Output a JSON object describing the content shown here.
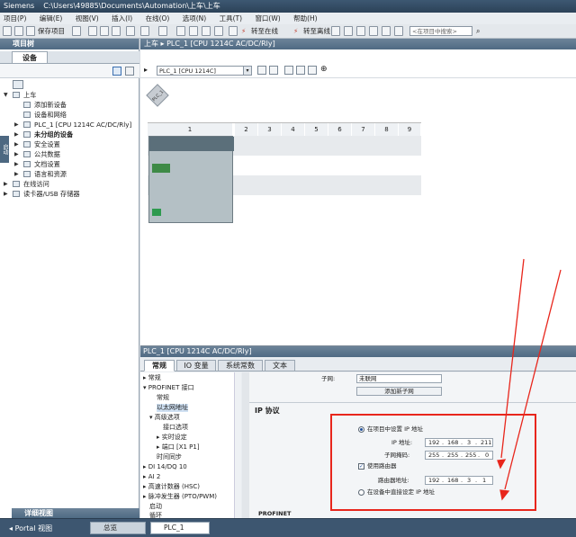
{
  "window": {
    "app": "Siemens",
    "path": "C:\\Users\\49885\\Documents\\Automation\\上车\\上车"
  },
  "menu": [
    "项目(P)",
    "编辑(E)",
    "视图(V)",
    "插入(I)",
    "在线(O)",
    "选项(N)",
    "工具(T)",
    "窗口(W)",
    "帮助(H)"
  ],
  "toolbar": {
    "save": "保存项目",
    "go_online": "转至在线",
    "go_offline": "转至离线",
    "search_placeholder": "<在项目中搜索>"
  },
  "left_panel": {
    "title": "项目树",
    "tab": "设备",
    "side_label": "启动",
    "tree": [
      {
        "label": "上车",
        "level": 0,
        "exp": "▼"
      },
      {
        "label": "添加新设备",
        "level": 1,
        "exp": ""
      },
      {
        "label": "设备和网络",
        "level": 1,
        "exp": ""
      },
      {
        "label": "PLC_1 [CPU 1214C AC/DC/Rly]",
        "level": 1,
        "exp": "▶"
      },
      {
        "label": "未分组的设备",
        "level": 1,
        "exp": "▶"
      },
      {
        "label": "安全设置",
        "level": 1,
        "exp": "▶"
      },
      {
        "label": "公共数据",
        "level": 1,
        "exp": "▶"
      },
      {
        "label": "文档设置",
        "level": 1,
        "exp": "▶"
      },
      {
        "label": "语言和资源",
        "level": 1,
        "exp": "▶"
      },
      {
        "label": "在线访问",
        "level": 0,
        "exp": "▶"
      },
      {
        "label": "读卡器/USB 存储器",
        "level": 0,
        "exp": "▶"
      }
    ],
    "details": "详细视图"
  },
  "breadcrumb": "上车 ▸ PLC_1 [CPU 1214C AC/DC/Rly]",
  "device_view": {
    "selector": "PLC_1 [CPU 1214C]",
    "badge": "PLC_1",
    "slots": [
      "1",
      "2",
      "3",
      "4",
      "5",
      "6",
      "7",
      "8",
      "9"
    ]
  },
  "properties": {
    "title": "PLC_1 [CPU 1214C AC/DC/Rly]",
    "tabs": [
      "常规",
      "IO 变量",
      "系统常数",
      "文本"
    ],
    "nav": [
      "常规",
      "PROFINET 接口",
      "常规",
      "以太网地址",
      "高级选项",
      "接口选项",
      "实时设定",
      "端口 [X1 P1]",
      "时间同步",
      "DI 14/DQ 10",
      "AI 2",
      "高速计数器 (HSC)",
      "脉冲发生器 (PTO/PWM)",
      "启动",
      "循环"
    ],
    "subnet_label": "子网:",
    "subnet_value": "未联网",
    "add_subnet": "添加新子网",
    "ip_section": "IP 协议",
    "opt_project_ip": "在项目中设置 IP 地址",
    "ip_label": "IP 地址:",
    "ip": [
      "192",
      "168",
      "3",
      "211"
    ],
    "mask_label": "子网掩码:",
    "mask": [
      "255",
      "255",
      "255",
      "0"
    ],
    "use_router": "使用路由器",
    "router_label": "路由器地址:",
    "router": [
      "192",
      "168",
      "3",
      "1"
    ],
    "opt_device_ip": "在设备中直接设定 IP 地址",
    "profinet": "PROFINET"
  },
  "taskbar": {
    "portal": "Portal 视图",
    "overview": "总览",
    "plc": "PLC_1"
  },
  "colors": {
    "accent": "#4f6a83",
    "highlight_box": "#e8261c"
  }
}
